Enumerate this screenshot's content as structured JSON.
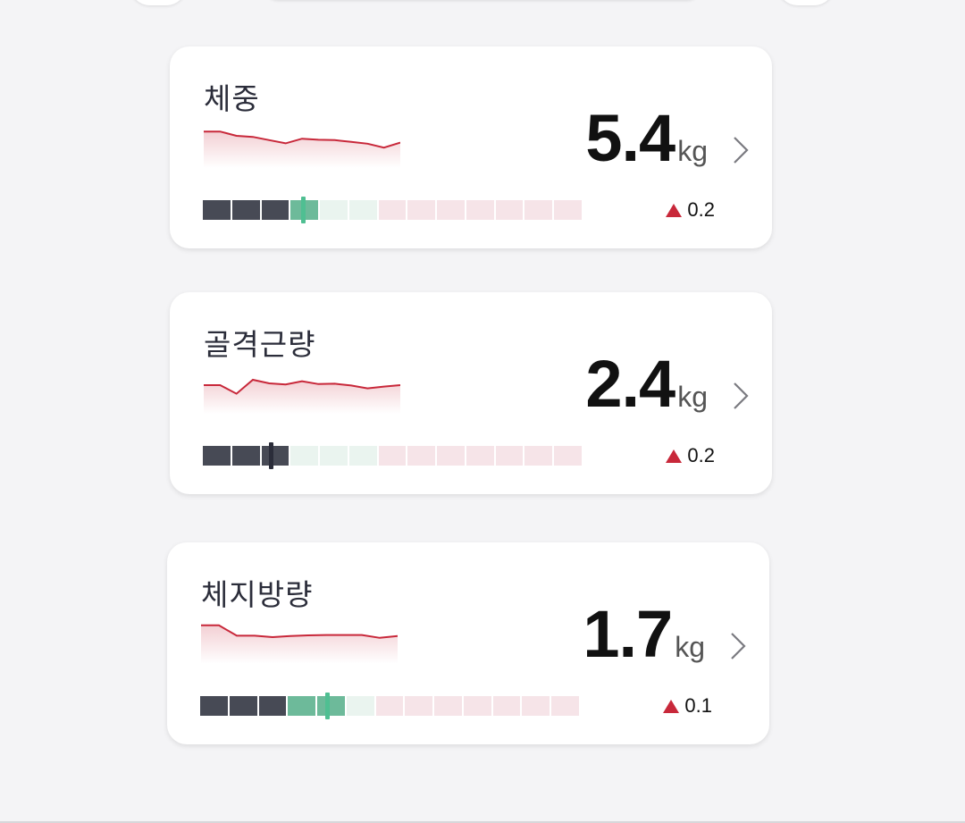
{
  "cards": [
    {
      "title": "체중",
      "value": "5.4",
      "unit": "kg",
      "change": "0.2",
      "change_direction": "up",
      "trend": [
        72,
        72,
        60,
        57,
        48,
        39,
        52,
        49,
        48,
        43,
        38,
        27,
        41
      ],
      "range_fill": [
        "dark",
        "dark",
        "dark",
        "green",
        "green-light",
        "green-light",
        "pink",
        "pink",
        "pink",
        "pink",
        "pink",
        "pink",
        "pink"
      ],
      "marker_position": 0.265,
      "marker_color": "#4fbf92"
    },
    {
      "title": "골격근량",
      "value": "2.4",
      "unit": "kg",
      "change": "0.2",
      "change_direction": "up",
      "trend": [
        50,
        50,
        26,
        65,
        55,
        52,
        61,
        53,
        54,
        49,
        41,
        46,
        50
      ],
      "range_fill": [
        "dark",
        "dark",
        "dark",
        "green-light",
        "green-light",
        "green-light",
        "pink",
        "pink",
        "pink",
        "pink",
        "pink",
        "pink",
        "pink"
      ],
      "marker_position": 0.18,
      "marker_color": "#2b2d3a"
    },
    {
      "title": "체지방량",
      "value": "1.7",
      "unit": "kg",
      "change": "0.1",
      "change_direction": "up",
      "trend": [
        78,
        78,
        49,
        49,
        45,
        48,
        50,
        51,
        51,
        51,
        43,
        48
      ],
      "range_fill": [
        "dark",
        "dark",
        "dark",
        "green",
        "green",
        "green-light",
        "pink",
        "pink",
        "pink",
        "pink",
        "pink",
        "pink",
        "pink"
      ],
      "marker_position": 0.335,
      "marker_color": "#4fbf92"
    }
  ],
  "colors": {
    "accent_red": "#c8283a",
    "dark_segment": "#474a55",
    "green_segment": "#6dba9a",
    "green_light_segment": "#eaf4ef",
    "pink_segment": "#f6e4e8",
    "marker_green": "#4fbf92"
  }
}
